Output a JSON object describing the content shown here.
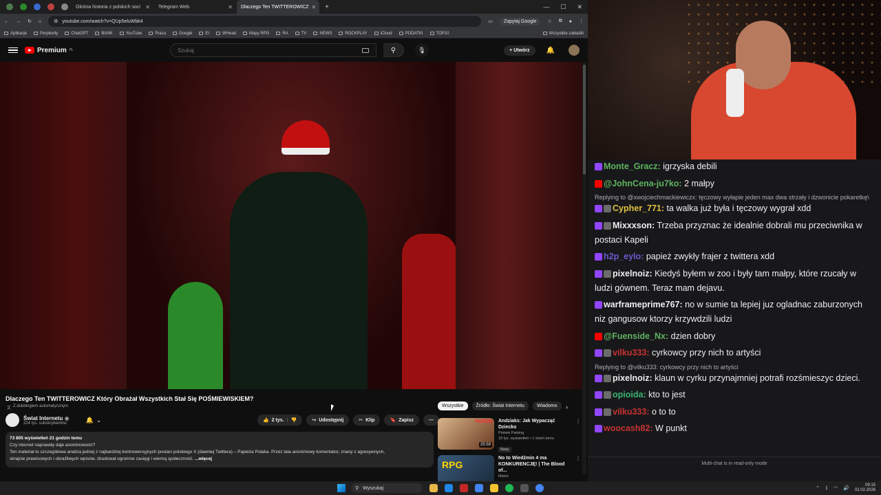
{
  "browser": {
    "tabs": [
      {
        "label": "Głośna historia z polskich soci"
      },
      {
        "label": "Telegram Web"
      },
      {
        "label": "Dlaczego Ten TWITTEROWICZ"
      }
    ],
    "url": "youtube.com/watch?v=QUp5eluWbk4",
    "ask_google": "Zapytaj Google",
    "bookmarks": [
      "Aplikacje",
      "Perplexity",
      "ChatGPT",
      "BANK",
      "YouTube",
      "Praca",
      "Google",
      "EI",
      "WHead",
      "Mapy RPG",
      "RA",
      "TV",
      "NEWS",
      "ROCKPLAY",
      "iCloud",
      "PODATKI",
      "TOP10"
    ],
    "bookmarks_right": "Wszystkie zakładki"
  },
  "youtube": {
    "logo": "Premium",
    "logo_region": "PL",
    "search_placeholder": "Szukaj",
    "create_label": "Utwórz",
    "video": {
      "title": "Dlaczego Ten TWITTEROWICZ Który Obrażał Wszystkich Stał Się POŚMIEWISKIEM?",
      "dubbing": "Z dubbingiem automatycznym",
      "channel": "Świat Internetu",
      "subscribers": "224 tys. subskrybentów",
      "likes": "2 tys.",
      "share": "Udostępnij",
      "clip": "Klip",
      "save": "Zapisz",
      "stats": "73 805 wyświetleń  21 godzin temu",
      "desc_line1": "Czy internet naprawdę daje anonimowość?",
      "desc_line2": "Ten materiał to szczegółowa analiza jednej z najbardziej kontrowersyjnych postaci polskiego X (dawniej Twittera) – Papieża Polaka. Przez lata anonimowy komentator, znany z agresywnych,",
      "desc_line3": "skrajnie prawicowych i obraźliwych wpisów, zbudował ogromne zasięgi i wierną społeczność.",
      "more": "...więcej"
    },
    "chips": [
      "Wszystkie",
      "Źródło: Świat Internetu",
      "Wiadomo"
    ],
    "recommendations": [
      {
        "title": "Andziaks: Jak Wypacząć Dziecko",
        "channel": "Piotrek Parking",
        "meta": "18 tys. wyświetleń • 1 dzień temu",
        "badge": "Nowy",
        "duration": "25:59",
        "thumb_text": "PORÓD"
      },
      {
        "title": "No to Wiedźmin 4 ma KONKURENCJĘ! | The Blood of...",
        "channel": "Mistre",
        "meta": "",
        "badge": "",
        "duration": "",
        "thumb_text": "RPG"
      }
    ]
  },
  "chat": {
    "messages": [
      {
        "badges": [
          "b-tw"
        ],
        "user": "Monte_Gracz:",
        "color": "#5fb35f",
        "text": "igrzyska debili"
      },
      {
        "badges": [
          "b-yt"
        ],
        "user": "@JohnCena-ju7ko:",
        "color": "#5fb35f",
        "text": "2 małpy"
      },
      {
        "reply": "Replying to @xwojciechmackiewiczx: tęczowy wyłapie jeden max dwa strzały i dzwonicie pokaretkę\\"
      },
      {
        "badges": [
          "b-tw",
          "b-k"
        ],
        "user": "Cypher_771:",
        "color": "#e0c040",
        "text": "ta walka już była i tęczowy wygrał xdd"
      },
      {
        "badges": [
          "b-tw",
          "b-k"
        ],
        "user": "Mixxxson:",
        "color": "#efeff1",
        "text": "Trzeba przyznac że idealnie dobrali mu przeciwnika w postaci Kapeli"
      },
      {
        "badges": [
          "b-tw"
        ],
        "user": "h2p_eylo:",
        "color": "#6a5acd",
        "text": "papież zwykły frajer z twittera xdd"
      },
      {
        "badges": [
          "b-tw",
          "b-k"
        ],
        "user": "pixelnoiz:",
        "color": "#efeff1",
        "text": "Kiedyś byłem w zoo i były tam małpy, które rzucały w ludzi gównem. Teraz mam dejavu."
      },
      {
        "badges": [
          "b-tw"
        ],
        "user": "warframeprime767:",
        "color": "#efeff1",
        "text": "no w sumie ta lepiej juz ogladnac zaburzonych niz gangusow ktorzy krzywdzili ludzi"
      },
      {
        "badges": [
          "b-yt"
        ],
        "user": "@Fuenside_Nx:",
        "color": "#5fb35f",
        "text": "dzien dobry"
      },
      {
        "badges": [
          "b-tw",
          "b-k"
        ],
        "user": "vilku333:",
        "color": "#c83232",
        "text": "cyrkowcy przy nich to artyści"
      },
      {
        "reply": "Replying to @vilku333: cyrkowcy przy nich to artyści"
      },
      {
        "badges": [
          "b-tw",
          "b-k"
        ],
        "user": "pixelnoiz:",
        "color": "#efeff1",
        "text": "klaun w cyrku przynajmniej potrafi rozśmieszyc dzieci."
      },
      {
        "badges": [
          "b-tw",
          "b-k"
        ],
        "user": "opioida:",
        "color": "#3cb371",
        "text": "kto to jest"
      },
      {
        "badges": [
          "b-tw",
          "b-k"
        ],
        "user": "vilku333:",
        "color": "#c83232",
        "text": "o to to"
      },
      {
        "badges": [
          "b-tw"
        ],
        "user": "woocash82:",
        "color": "#c83232",
        "text": "W punkt"
      }
    ],
    "footer": "Multi-chat is in read-only mode"
  },
  "taskbar": {
    "search": "Wyszukaj",
    "time": "09:15",
    "date": "02.02.2026"
  }
}
